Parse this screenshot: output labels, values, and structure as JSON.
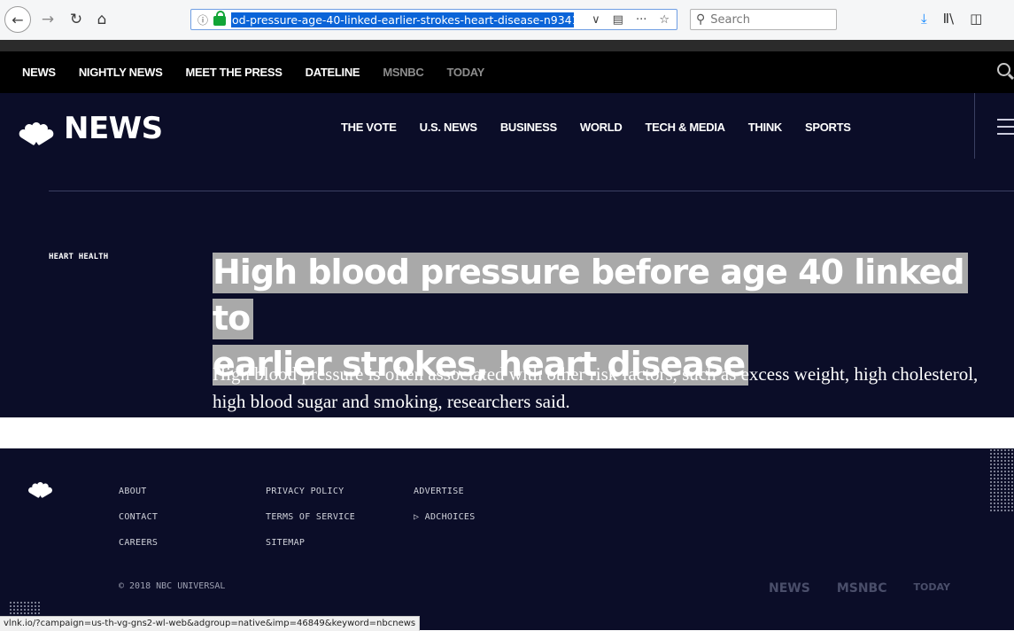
{
  "browser": {
    "url": "od-pressure-age-40-linked-earlier-strokes-heart-disease-n934141",
    "search_placeholder": "Search",
    "back_glyph": "←",
    "forward_glyph": "→",
    "reload_glyph": "↻",
    "home_glyph": "⌂",
    "info_glyph": "ⓘ",
    "dropdown_glyph": "∨",
    "reader_glyph": "▤",
    "more_glyph": "···",
    "bookmark_glyph": "☆",
    "download_glyph": "⤓",
    "library_glyph": "Ⅱ\\",
    "sidebar_glyph": "◫"
  },
  "top_nav": {
    "items": [
      "NEWS",
      "NIGHTLY NEWS",
      "MEET THE PRESS",
      "DATELINE",
      "MSNBC",
      "TODAY"
    ]
  },
  "header": {
    "brand": "NEWS",
    "nav": [
      "THE VOTE",
      "U.S. NEWS",
      "BUSINESS",
      "WORLD",
      "TECH & MEDIA",
      "THINK",
      "SPORTS"
    ]
  },
  "article": {
    "kicker": "HEART HEALTH",
    "headline_line1": "High blood pressure before age 40 linked to",
    "headline_line2": "earlier strokes, heart disease",
    "dek": "High blood pressure is often associated with other risk factors, such as excess weight, high cholesterol, high blood sugar and smoking, researchers said."
  },
  "footer": {
    "col1": [
      "ABOUT",
      "CONTACT",
      "CAREERS"
    ],
    "col2": [
      "PRIVACY POLICY",
      "TERMS OF SERVICE",
      "SITEMAP"
    ],
    "col3": [
      "ADVERTISE",
      "▷ ADCHOICES"
    ],
    "copyright": "© 2018 NBC UNIVERSAL",
    "logos": [
      "NEWS",
      "MSNBC",
      "TODAY"
    ]
  },
  "status_bar": "vlnk.io/?campaign=us-th-vg-gns2-wl-web&adgroup=native&imp=46849&keyword=nbcnews",
  "colors": {
    "hero_bg": "#0b0d28",
    "top_nav_bg": "#000000",
    "selection_highlight": "#a9a9a9",
    "url_selection": "#0a64d8"
  }
}
